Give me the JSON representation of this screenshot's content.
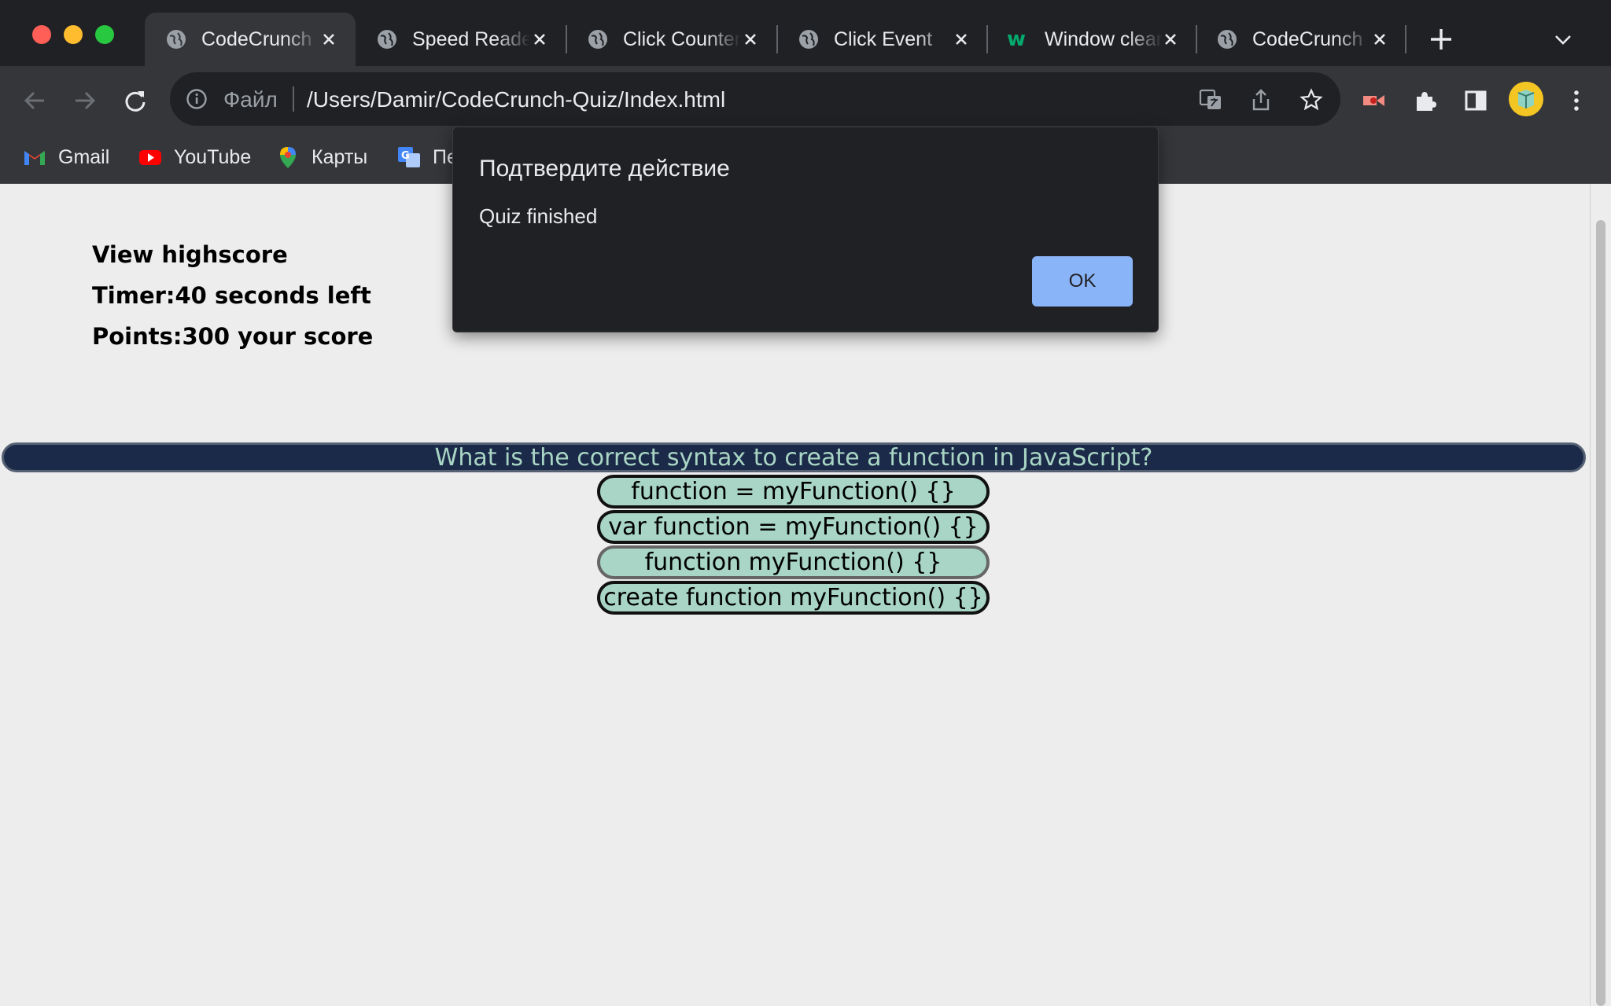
{
  "browser": {
    "tabs": [
      {
        "title": "CodeCrunch",
        "favicon": "globe-icon",
        "active": true
      },
      {
        "title": "Speed Reader",
        "favicon": "globe-icon",
        "active": false
      },
      {
        "title": "Click Counter",
        "favicon": "globe-icon",
        "active": false
      },
      {
        "title": "Click Event",
        "favicon": "globe-icon",
        "active": false
      },
      {
        "title": "Window clear",
        "favicon": "w3schools-icon",
        "active": false
      },
      {
        "title": "CodeCrunch",
        "favicon": "globe-icon",
        "active": false
      }
    ],
    "address": {
      "scheme_label": "Файл",
      "url": "/Users/Damir/CodeCrunch-Quiz/Index.html"
    },
    "bookmarks": [
      {
        "label": "Gmail",
        "icon": "gmail-icon"
      },
      {
        "label": "YouTube",
        "icon": "youtube-icon"
      },
      {
        "label": "Карты",
        "icon": "maps-icon"
      },
      {
        "label": "Пе",
        "icon": "google-translate-icon"
      }
    ]
  },
  "page": {
    "view_highscore": "View highscore",
    "timer": "Timer:40 seconds left",
    "points": "Points:300 your score",
    "question": "What is the correct syntax to create a function in JavaScript?",
    "answers": [
      "function = myFunction() {}",
      "var function = myFunction() {}",
      "function myFunction() {}",
      "create function myFunction() {}"
    ]
  },
  "dialog": {
    "title": "Подтвердите действие",
    "message": "Quiz finished",
    "ok_label": "OK"
  },
  "colors": {
    "question_bg": "#1c2a4a",
    "question_text": "#a9d6c4",
    "answer_bg": "#a8d5c6",
    "ok_button": "#8ab4f8"
  }
}
